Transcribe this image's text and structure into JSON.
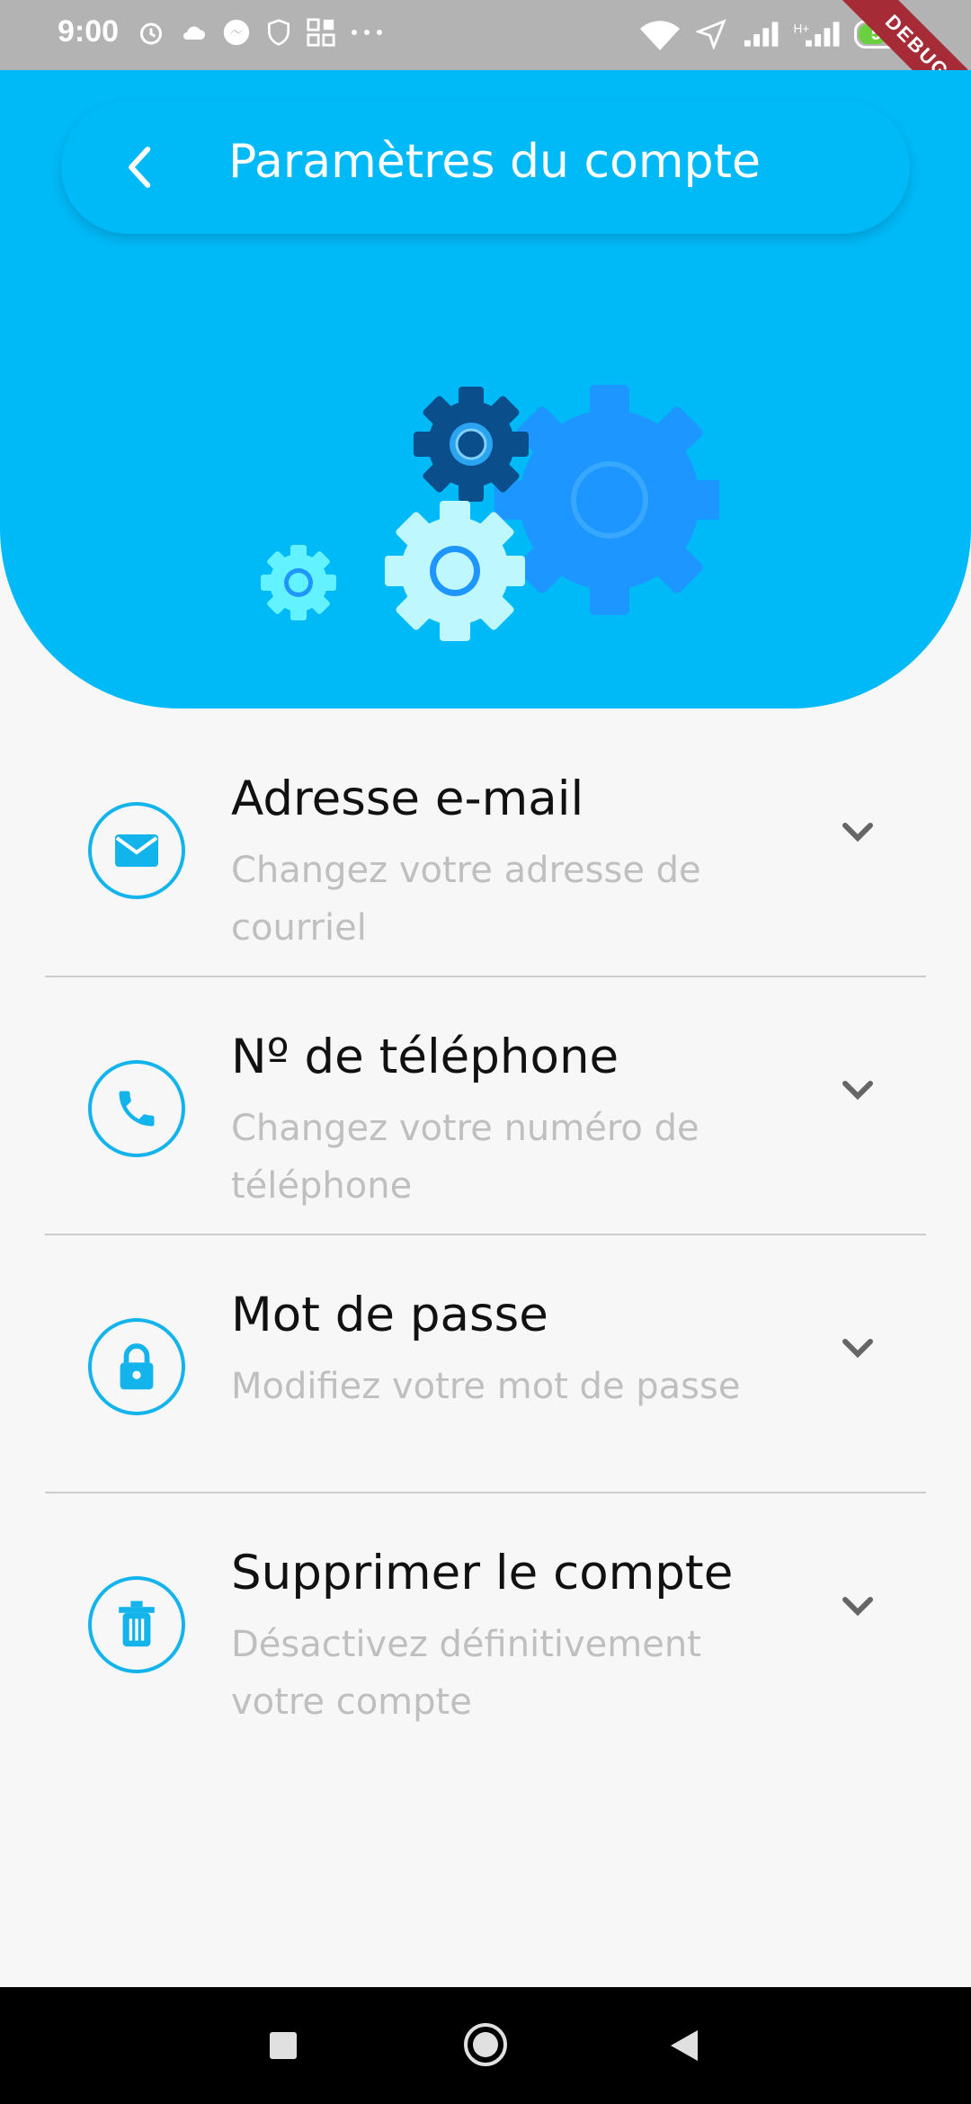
{
  "status_bar": {
    "time": "9:00",
    "battery": "57",
    "debug_banner": "DEBUG"
  },
  "header": {
    "title": "Paramètres du compte",
    "back_icon": "chevron-left-icon"
  },
  "colors": {
    "primary": "#00b9f7",
    "icon_blue": "#13b4ec",
    "gear_dark": "#0a4f8c",
    "gear_mid": "#1e96ff",
    "gear_light": "#bff7ff",
    "gear_aqua": "#63f2ff"
  },
  "settings": [
    {
      "title": "Adresse e-mail",
      "subtitle": "Changez votre adresse de courriel",
      "icon": "email-icon"
    },
    {
      "title": "Nº de téléphone",
      "subtitle": "Changez votre numéro de téléphone",
      "icon": "phone-icon"
    },
    {
      "title": "Mot de passe",
      "subtitle": "Modifiez votre mot de passe",
      "icon": "lock-icon"
    },
    {
      "title": "Supprimer le compte",
      "subtitle": "Désactivez définitivement votre compte",
      "icon": "trash-icon"
    }
  ]
}
